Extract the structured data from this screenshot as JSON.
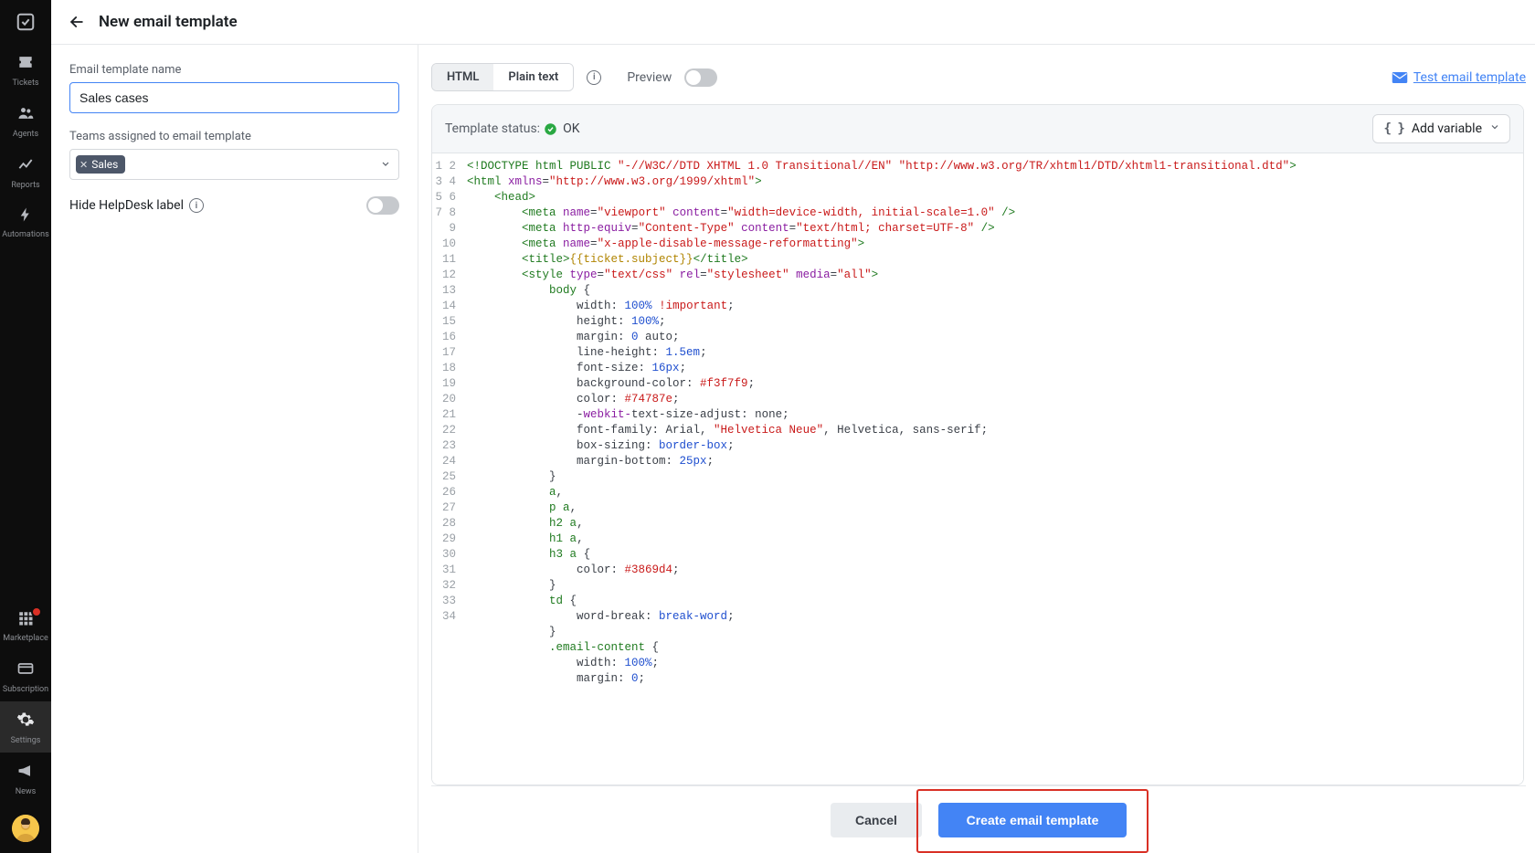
{
  "sidebar": {
    "items": [
      {
        "label": "Tickets"
      },
      {
        "label": "Agents"
      },
      {
        "label": "Reports"
      },
      {
        "label": "Automations"
      }
    ],
    "bottom": [
      {
        "label": "Marketplace",
        "badge": true
      },
      {
        "label": "Subscription"
      },
      {
        "label": "Settings",
        "active": true
      },
      {
        "label": "News"
      }
    ]
  },
  "header": {
    "title": "New email template"
  },
  "form": {
    "name_label": "Email template name",
    "name_value": "Sales cases",
    "teams_label": "Teams assigned to email template",
    "teams_chip": "Sales",
    "hide_label": "Hide HelpDesk label"
  },
  "toolbar": {
    "html_tab": "HTML",
    "plain_tab": "Plain text",
    "preview_label": "Preview",
    "test_link": "Test email template",
    "status_label": "Template status:",
    "status_value": "OK",
    "add_variable": "Add variable"
  },
  "footer": {
    "cancel": "Cancel",
    "create": "Create email template"
  },
  "code_lines": 34,
  "code": {
    "l1a": "<!DOCTYPE html PUBLIC ",
    "l1b": "\"-//W3C//DTD XHTML 1.0 Transitional//EN\"",
    "l1c": " ",
    "l1d": "\"http://www.w3.org/TR/xhtml1/DTD/xhtml1-transitional.dtd\"",
    "l1e": ">",
    "l2a": "<html",
    "l2b": " xmlns",
    "l2c": "=",
    "l2d": "\"http://www.w3.org/1999/xhtml\"",
    "l2e": ">",
    "l3a": "    ",
    "l3b": "<head>",
    "l4a": "        ",
    "l4b": "<meta",
    "l4c": " name",
    "l4d": "=",
    "l4e": "\"viewport\"",
    "l4f": " content",
    "l4g": "=",
    "l4h": "\"width=device-width, initial-scale=1.0\"",
    "l4i": " />",
    "l5a": "        ",
    "l5b": "<meta",
    "l5c": " http-equiv",
    "l5d": "=",
    "l5e": "\"Content-Type\"",
    "l5f": " content",
    "l5g": "=",
    "l5h": "\"text/html; charset=UTF-8\"",
    "l5i": " />",
    "l6a": "        ",
    "l6b": "<meta",
    "l6c": " name",
    "l6d": "=",
    "l6e": "\"x-apple-disable-message-reformatting\"",
    "l6f": ">",
    "l7a": "        ",
    "l7b": "<title>",
    "l7c": "{{ticket.subject}}",
    "l7d": "</title>",
    "l8a": "        ",
    "l8b": "<style",
    "l8c": " type",
    "l8d": "=",
    "l8e": "\"text/css\"",
    "l8f": " rel",
    "l8g": "=",
    "l8h": "\"stylesheet\"",
    "l8i": " media",
    "l8j": "=",
    "l8k": "\"all\"",
    "l8l": ">",
    "l9a": "            ",
    "l9b": "body",
    "l9c": " {",
    "l10a": "                width: ",
    "l10b": "100%",
    "l10c": " ",
    "l10d": "!important",
    "l10e": ";",
    "l11a": "                height: ",
    "l11b": "100%",
    "l11c": ";",
    "l12a": "                margin: ",
    "l12b": "0",
    "l12c": " auto;",
    "l13a": "                line-height: ",
    "l13b": "1.5em",
    "l13c": ";",
    "l14a": "                font-size: ",
    "l14b": "16px",
    "l14c": ";",
    "l15a": "                background-color: ",
    "l15b": "#f3f7f9",
    "l15c": ";",
    "l16a": "                color: ",
    "l16b": "#74787e",
    "l16c": ";",
    "l17a": "                -",
    "l17b": "webkit-",
    "l17c": "text-size-adjust: none;",
    "l18a": "                font-family: Arial, ",
    "l18b": "\"Helvetica Neue\"",
    "l18c": ", Helvetica, sans-serif;",
    "l19a": "                box-sizing: ",
    "l19b": "border-box",
    "l19c": ";",
    "l20a": "                margin-bottom: ",
    "l20b": "25px",
    "l20c": ";",
    "l21": "            }",
    "l22a": "            ",
    "l22b": "a",
    "l22c": ",",
    "l23a": "            ",
    "l23b": "p",
    "l23c": " ",
    "l23d": "a",
    "l23e": ",",
    "l24a": "            ",
    "l24b": "h2",
    "l24c": " ",
    "l24d": "a",
    "l24e": ",",
    "l25a": "            ",
    "l25b": "h1",
    "l25c": " ",
    "l25d": "a",
    "l25e": ",",
    "l26a": "            ",
    "l26b": "h3",
    "l26c": " ",
    "l26d": "a",
    "l26e": " {",
    "l27a": "                color: ",
    "l27b": "#3869d4",
    "l27c": ";",
    "l28": "            }",
    "l29a": "            ",
    "l29b": "td",
    "l29c": " {",
    "l30a": "                word-break: ",
    "l30b": "break-word",
    "l30c": ";",
    "l31": "            }",
    "l32a": "            ",
    "l32b": ".email-content",
    "l32c": " {",
    "l33a": "                width: ",
    "l33b": "100%",
    "l33c": ";",
    "l34a": "                margin: ",
    "l34b": "0",
    "l34c": ";"
  }
}
